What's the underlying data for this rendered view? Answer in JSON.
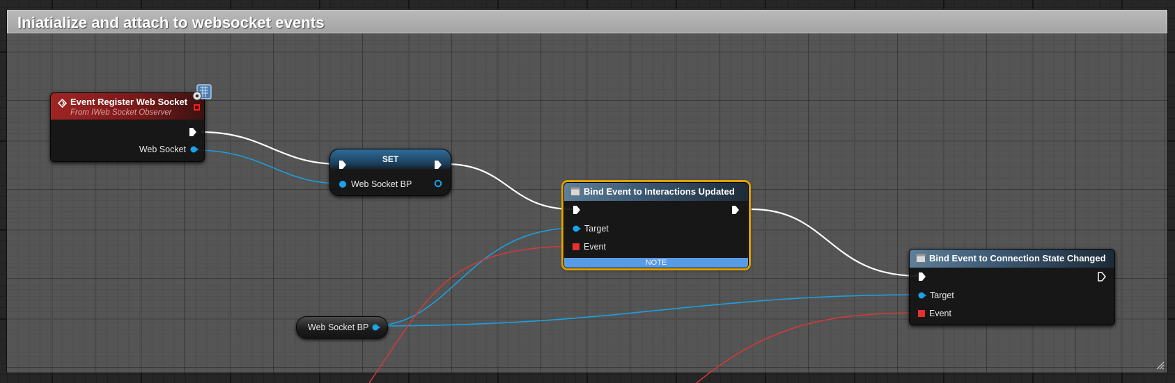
{
  "comment": {
    "title": "Iniatialize and attach to websocket events",
    "color": "#a8a8a8"
  },
  "nodes": {
    "event_register": {
      "title": "Event Register Web Socket",
      "subtitle": "From IWeb Socket Observer",
      "output_pin": "Web Socket",
      "header_color": "#a02424",
      "icon": "event-diamond-icon"
    },
    "set_node": {
      "title": "SET",
      "variable_pin": "Web Socket BP",
      "header_color": "#2f6c9a"
    },
    "bind_interactions": {
      "title": "Bind Event to Interactions Updated",
      "target_pin": "Target",
      "event_pin": "Event",
      "note": "NOTE",
      "selected": true,
      "selection_color": "#e0a000"
    },
    "bind_connection": {
      "title": "Bind Event to Connection State Changed",
      "target_pin": "Target",
      "event_pin": "Event"
    },
    "getter": {
      "label": "Web Socket BP"
    }
  },
  "wire_colors": {
    "exec": "#ffffff",
    "object": "#1aa0e0",
    "delegate": "#d83838"
  },
  "pin_colors": {
    "object": "#19a4e8",
    "delegate": "#e83030"
  }
}
